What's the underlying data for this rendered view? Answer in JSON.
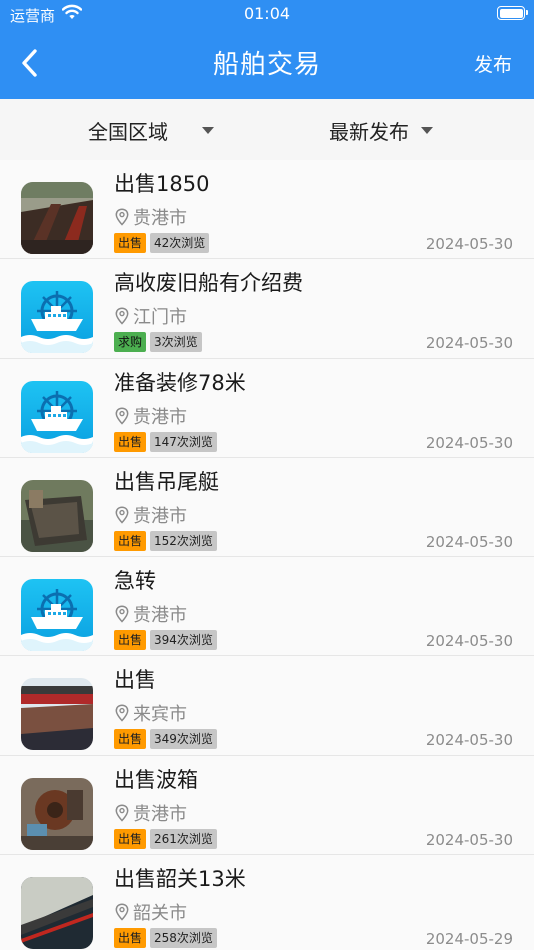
{
  "status_bar": {
    "carrier": "运营商",
    "time": "01:04"
  },
  "nav": {
    "title": "船舶交易",
    "publish_label": "发布",
    "back_icon": "chevron-left-icon"
  },
  "filters": {
    "region_label": "全国区域",
    "sort_label": "最新发布",
    "dropdown_icon": "triangle-down-icon"
  },
  "colors": {
    "header": "#2f8ff3",
    "sell_tag": "#ff9a00",
    "buy_tag": "#4caf50",
    "views_tag": "#c6c6c6"
  },
  "listings": [
    {
      "title": "出售1850",
      "location": "贵港市",
      "type_tag": "出售",
      "type": "sell",
      "views": "42次浏览",
      "date": "2024-05-30",
      "thumb": "photo"
    },
    {
      "title": "高收废旧船有介绍费",
      "location": "江门市",
      "type_tag": "求购",
      "type": "buy",
      "views": "3次浏览",
      "date": "2024-05-30",
      "thumb": "ship-logo"
    },
    {
      "title": "准备装修78米",
      "location": "贵港市",
      "type_tag": "出售",
      "type": "sell",
      "views": "147次浏览",
      "date": "2024-05-30",
      "thumb": "ship-logo"
    },
    {
      "title": "出售吊尾艇",
      "location": "贵港市",
      "type_tag": "出售",
      "type": "sell",
      "views": "152次浏览",
      "date": "2024-05-30",
      "thumb": "photo"
    },
    {
      "title": "急转",
      "location": "贵港市",
      "type_tag": "出售",
      "type": "sell",
      "views": "394次浏览",
      "date": "2024-05-30",
      "thumb": "ship-logo"
    },
    {
      "title": "出售",
      "location": "来宾市",
      "type_tag": "出售",
      "type": "sell",
      "views": "349次浏览",
      "date": "2024-05-30",
      "thumb": "photo"
    },
    {
      "title": "出售波箱",
      "location": "贵港市",
      "type_tag": "出售",
      "type": "sell",
      "views": "261次浏览",
      "date": "2024-05-30",
      "thumb": "photo"
    },
    {
      "title": "出售韶关13米",
      "location": "韶关市",
      "type_tag": "出售",
      "type": "sell",
      "views": "258次浏览",
      "date": "2024-05-29",
      "thumb": "photo"
    }
  ]
}
